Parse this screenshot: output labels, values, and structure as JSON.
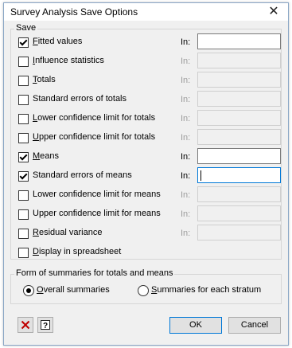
{
  "window": {
    "title": "Survey Analysis Save Options",
    "close_glyph": "✕"
  },
  "save": {
    "group_label": "Save",
    "in_label": "In:",
    "items": [
      {
        "pre": "",
        "u": "F",
        "post": "itted values",
        "checked": true,
        "enabled": true
      },
      {
        "pre": "",
        "u": "I",
        "post": "nfluence statistics",
        "checked": false,
        "enabled": false
      },
      {
        "pre": "",
        "u": "T",
        "post": "otals",
        "checked": false,
        "enabled": false
      },
      {
        "pre": "Standard errors of totals",
        "u": "",
        "post": "",
        "checked": false,
        "enabled": false
      },
      {
        "pre": "",
        "u": "L",
        "post": "ower confidence limit for totals",
        "checked": false,
        "enabled": false
      },
      {
        "pre": "",
        "u": "U",
        "post": "pper confidence limit for totals",
        "checked": false,
        "enabled": false
      },
      {
        "pre": "",
        "u": "M",
        "post": "eans",
        "checked": true,
        "enabled": true
      },
      {
        "pre": "Standard errors of means",
        "u": "",
        "post": "",
        "checked": true,
        "enabled": true,
        "focused": true
      },
      {
        "pre": "Lower confidence limit for means",
        "u": "",
        "post": "",
        "checked": false,
        "enabled": false
      },
      {
        "pre": "Upper confidence limit for means",
        "u": "",
        "post": "",
        "checked": false,
        "enabled": false
      },
      {
        "pre": "",
        "u": "R",
        "post": "esidual variance",
        "checked": false,
        "enabled": false
      }
    ],
    "display_spreadsheet": {
      "pre": "",
      "u": "D",
      "post": "isplay in spreadsheet",
      "checked": false
    }
  },
  "form": {
    "group_label": "Form of summaries for totals and means",
    "options": [
      {
        "pre": "",
        "u": "O",
        "post": "verall summaries",
        "selected": true
      },
      {
        "pre": "",
        "u": "S",
        "post": "ummaries for each stratum",
        "selected": false
      }
    ]
  },
  "buttons": {
    "ok": "OK",
    "cancel": "Cancel"
  },
  "icons": {
    "clear": "clear-icon",
    "help": "help-icon"
  },
  "colors": {
    "clear_icon": "#c00000",
    "focus_border": "#0078d7"
  }
}
